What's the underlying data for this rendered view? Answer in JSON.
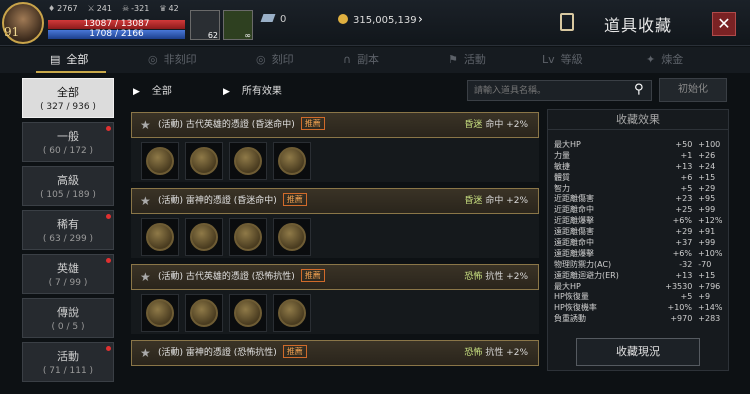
{
  "header": {
    "level": "91",
    "stats": [
      {
        "icon": "gem-stat-icon",
        "value": "2767"
      },
      {
        "icon": "sword-stat-icon",
        "value": "241"
      },
      {
        "icon": "skull-stat-icon",
        "value": "-321"
      },
      {
        "icon": "trophy-stat-icon",
        "value": "42"
      }
    ],
    "hp": "13087 / 13087",
    "mp": "1708 / 2166",
    "potion_a_count": "62",
    "potion_b_count": "∞",
    "gems": "0",
    "gold": "315,005,139",
    "title": "道具收藏",
    "close_label": "✕"
  },
  "tabs": [
    {
      "label": "全部",
      "icon": "book-icon"
    },
    {
      "label": "非刻印",
      "icon": "seal-icon"
    },
    {
      "label": "刻印",
      "icon": "seal-icon"
    },
    {
      "label": "副本",
      "icon": "magnet-icon"
    },
    {
      "label": "活動",
      "icon": "flag-icon"
    },
    {
      "label": "等級",
      "icon": "level-icon"
    },
    {
      "label": "煉金",
      "icon": "alchemy-icon"
    }
  ],
  "sidebar": [
    {
      "label": "全部",
      "count": "( 327 / 936 )"
    },
    {
      "label": "一般",
      "count": "( 60 / 172 )"
    },
    {
      "label": "高級",
      "count": "( 105 / 189 )"
    },
    {
      "label": "稀有",
      "count": "( 63 / 299 )"
    },
    {
      "label": "英雄",
      "count": "( 7 / 99 )"
    },
    {
      "label": "傳說",
      "count": "( 0 / 5 )"
    },
    {
      "label": "活動",
      "count": "( 71 / 111 )"
    }
  ],
  "filter": {
    "category": "全部",
    "effect": "所有效果",
    "search_placeholder": "請輸入道具名稱。",
    "reset_label": "初始化"
  },
  "groups": [
    {
      "name": "(活動) 古代英雄的憑證 (昏迷命中)",
      "badge": "推薦",
      "effect_a": "昏迷",
      "effect_b": "命中 +2%"
    },
    {
      "name": "(活動) 雷神的憑證 (昏迷命中)",
      "badge": "推薦",
      "effect_a": "昏迷",
      "effect_b": "命中 +2%"
    },
    {
      "name": "(活動) 古代英雄的憑證 (恐怖抗性)",
      "badge": "推薦",
      "effect_a": "恐怖",
      "effect_b": "抗性 +2%"
    },
    {
      "name": "(活動) 雷神的憑證 (恐怖抗性)",
      "badge": "推薦",
      "effect_a": "恐怖",
      "effect_b": "抗性 +2%"
    }
  ],
  "panel": {
    "title": "收藏效果",
    "rows": [
      {
        "k": "最大HP",
        "v1": "+50",
        "v2": "+100"
      },
      {
        "k": "力量",
        "v1": "+1",
        "v2": "+26"
      },
      {
        "k": "敏捷",
        "v1": "+13",
        "v2": "+24"
      },
      {
        "k": "體質",
        "v1": "+6",
        "v2": "+15"
      },
      {
        "k": "智力",
        "v1": "+5",
        "v2": "+29"
      },
      {
        "k": "近距離傷害",
        "v1": "+23",
        "v2": "+95"
      },
      {
        "k": "近距離命中",
        "v1": "+25",
        "v2": "+99"
      },
      {
        "k": "近距離爆擊",
        "v1": "+6%",
        "v2": "+12%"
      },
      {
        "k": "遠距離傷害",
        "v1": "+29",
        "v2": "+91"
      },
      {
        "k": "遠距離命中",
        "v1": "+37",
        "v2": "+99"
      },
      {
        "k": "遠距離爆擊",
        "v1": "+6%",
        "v2": "+10%"
      },
      {
        "k": "物理防禦力(AC)",
        "v1": "-32",
        "v2": "-70"
      },
      {
        "k": "遠距離迴避力(ER)",
        "v1": "+13",
        "v2": "+15"
      },
      {
        "k": "最大HP",
        "v1": "+3530",
        "v2": "+796"
      },
      {
        "k": "HP恢復量",
        "v1": "+5",
        "v2": "+9"
      },
      {
        "k": "HP恢復機率",
        "v1": "+10%",
        "v2": "+14%"
      },
      {
        "k": "負重誘動",
        "v1": "+970",
        "v2": "+283"
      }
    ],
    "button_label": "收藏現況"
  }
}
